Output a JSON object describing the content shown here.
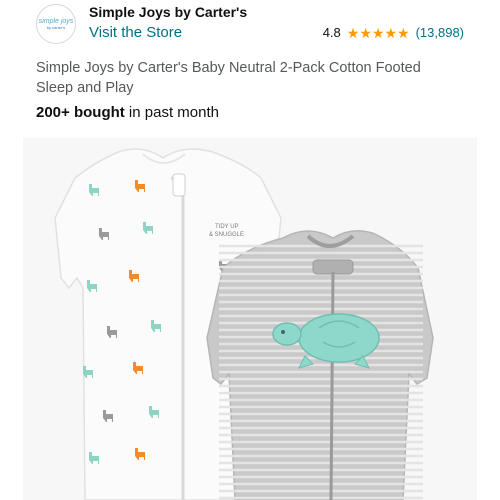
{
  "brand": {
    "logo_line1": "simple joys",
    "logo_line2": "by carter's",
    "name": "Simple Joys by Carter's",
    "store_link": "Visit the Store"
  },
  "rating": {
    "value": "4.8",
    "stars": 5,
    "count": "(13,898)"
  },
  "product": {
    "title": "Simple Joys by Carter's Baby Neutral 2-Pack Cotton Footed Sleep and Play",
    "bought_bold": "200+ bought",
    "bought_rest": " in past month",
    "image_alt": "Two baby sleep and play footies: white with llama print, grey striped with turtle",
    "onesie_text_1": "TIDY UP",
    "onesie_text_2": "& SNUGGLE"
  },
  "colors": {
    "link": "#007185",
    "star": "#ff9900",
    "llama_orange": "#f28b30",
    "llama_teal": "#8fd3c4",
    "llama_grey": "#9a9a9a",
    "turtle": "#8ed8cb"
  }
}
